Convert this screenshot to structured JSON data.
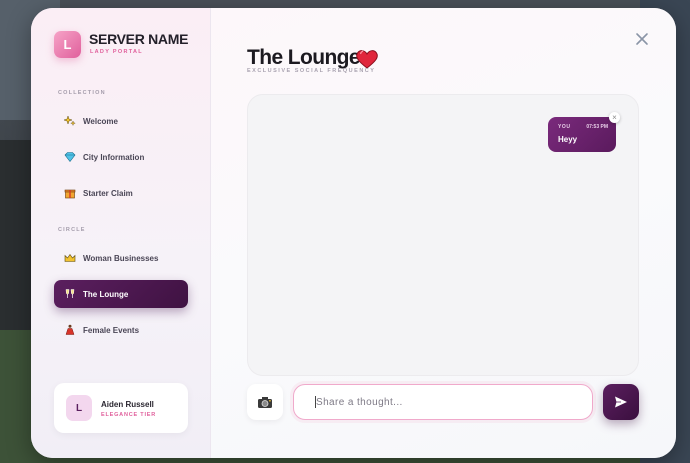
{
  "brand": {
    "logo_letter": "L",
    "server_name": "SERVER NAME",
    "subtitle": "LADY PORTAL"
  },
  "sidebar": {
    "sections": [
      {
        "label": "COLLECTION",
        "items": [
          {
            "label": "Welcome",
            "icon": "sparkles-icon"
          },
          {
            "label": "City Information",
            "icon": "gem-icon"
          },
          {
            "label": "Starter Claim",
            "icon": "gift-icon"
          }
        ]
      },
      {
        "label": "CIRCLE",
        "items": [
          {
            "label": "Woman Businesses",
            "icon": "crown-icon"
          },
          {
            "label": "The Lounge",
            "icon": "champagne-icon",
            "active": true
          },
          {
            "label": "Female Events",
            "icon": "dancer-icon"
          }
        ]
      }
    ]
  },
  "user": {
    "avatar_letter": "L",
    "name": "Aiden Russell",
    "tier": "ELEGANCE TIER"
  },
  "lounge": {
    "title": "The Lounge",
    "subtitle": "EXCLUSIVE SOCIAL FREQUENCY"
  },
  "messages": [
    {
      "sender": "YOU",
      "time": "07:53 PM",
      "text": "Heyy"
    }
  ],
  "composer": {
    "placeholder": "Share a thought...",
    "value": ""
  },
  "colors": {
    "accent_pink": "#e0609c",
    "accent_plum": "#5b1f5f",
    "heart_red": "#e0263c"
  }
}
